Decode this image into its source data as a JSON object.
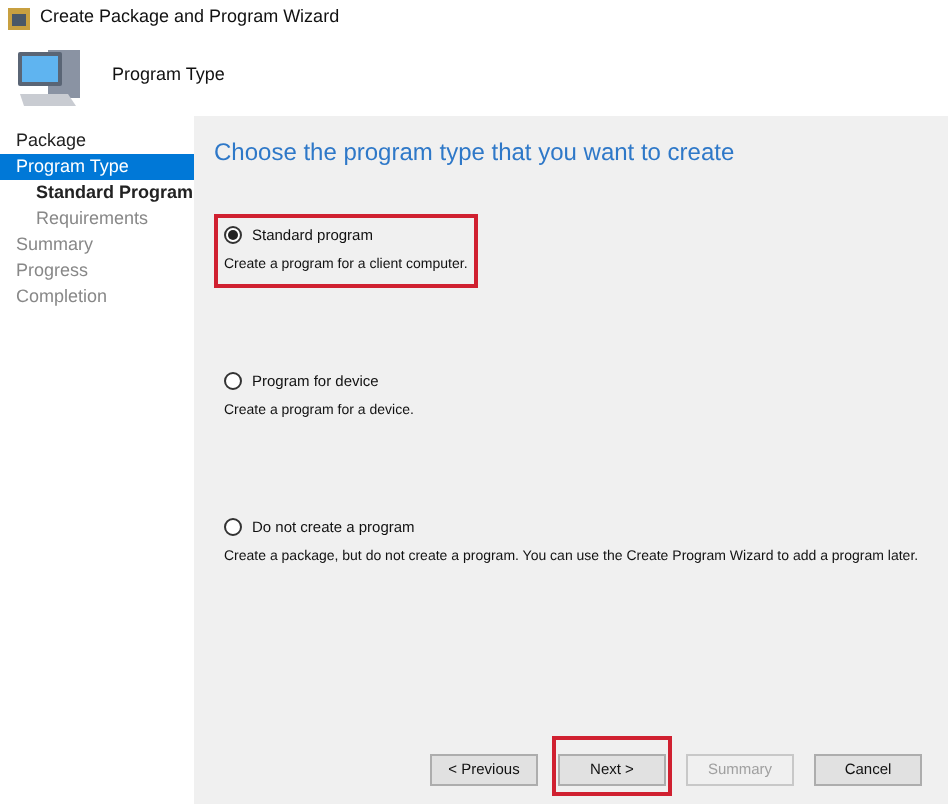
{
  "window": {
    "title": "Create Package and Program Wizard"
  },
  "header": {
    "title": "Program Type"
  },
  "steps": [
    {
      "label": "Package",
      "selected": false,
      "visited": true
    },
    {
      "label": "Program Type",
      "selected": true,
      "visited": true,
      "children": [
        {
          "label": "Standard Program",
          "selected": false,
          "visited": true
        },
        {
          "label": "Requirements",
          "selected": false,
          "visited": false
        }
      ]
    },
    {
      "label": "Summary",
      "selected": false,
      "visited": false
    },
    {
      "label": "Progress",
      "selected": false,
      "visited": false
    },
    {
      "label": "Completion",
      "selected": false,
      "visited": false
    }
  ],
  "heading": "Choose the program type that you want to create",
  "options": [
    {
      "label": "Standard program",
      "description": "Create a program for a client computer.",
      "selected": true,
      "highlighted": true
    },
    {
      "label": "Program for device",
      "description": "Create a program for a device.",
      "selected": false,
      "highlighted": false
    },
    {
      "label": "Do not create a program",
      "description": "Create a package, but do not create a program. You can use the Create Program Wizard to add a program later.",
      "selected": false,
      "highlighted": false
    }
  ],
  "buttons": [
    {
      "label": "< Previous",
      "disabled": false,
      "highlighted": false
    },
    {
      "label": "Next >",
      "disabled": false,
      "highlighted": true
    },
    {
      "label": "Summary",
      "disabled": true,
      "highlighted": false
    },
    {
      "label": "Cancel",
      "disabled": false,
      "highlighted": false
    }
  ]
}
